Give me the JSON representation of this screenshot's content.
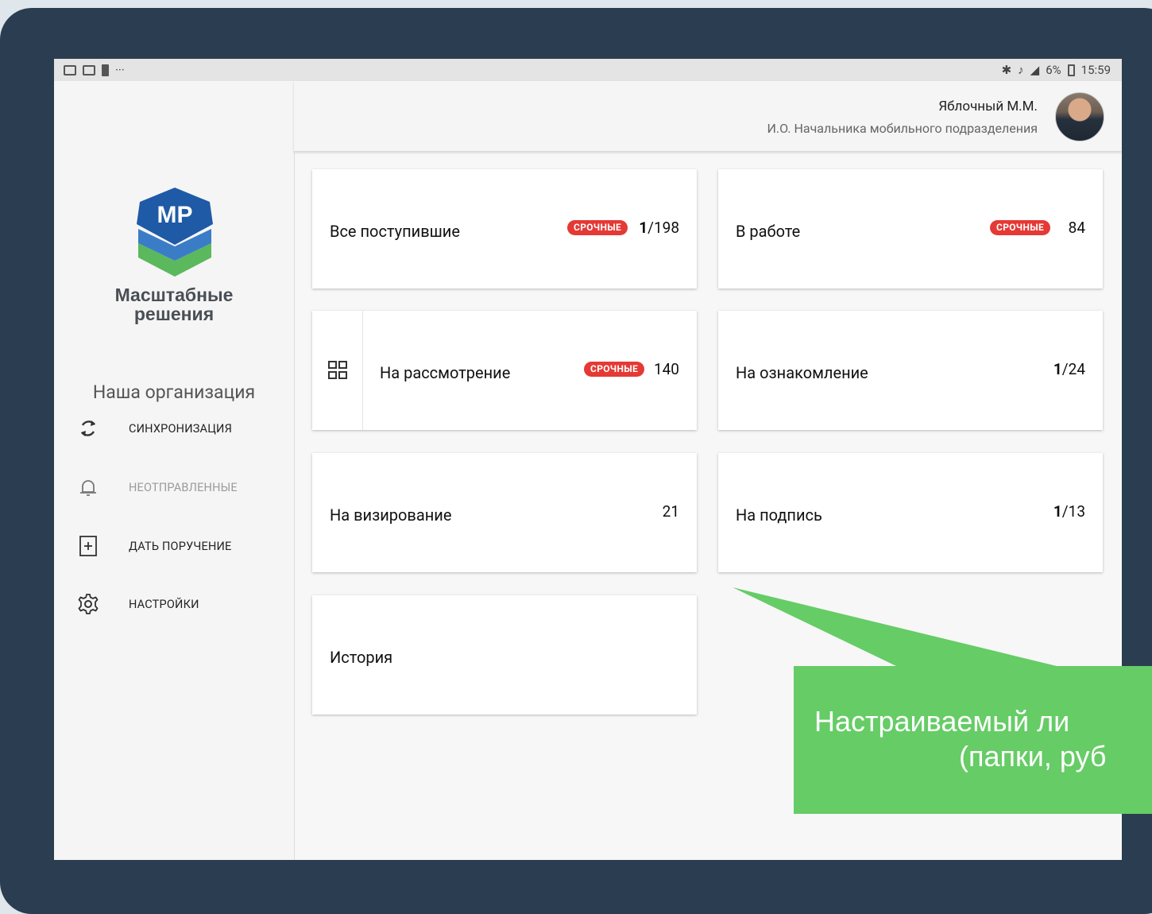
{
  "status_bar": {
    "left_dots": "···",
    "battery_percent": "6%",
    "time": "15:59"
  },
  "sidebar": {
    "logo_text": "MP",
    "brand_line1": "Масштабные",
    "brand_line2": "решения",
    "organization": "Наша организация",
    "items": [
      {
        "label": "СИНХРОНИЗАЦИЯ",
        "icon": "sync-icon",
        "enabled": true
      },
      {
        "label": "НЕОТПРАВЛЕННЫЕ",
        "icon": "bell-icon",
        "enabled": false
      },
      {
        "label": "ДАТЬ ПОРУЧЕНИЕ",
        "icon": "add-box-icon",
        "enabled": true
      },
      {
        "label": "НАСТРОЙКИ",
        "icon": "gear-icon",
        "enabled": true
      }
    ]
  },
  "header": {
    "user_name": "Яблочный М.М.",
    "user_role": "И.О. Начальника мобильного подразделения"
  },
  "cards": [
    {
      "title": "Все поступившие",
      "urgent": "СРОЧНЫЕ",
      "count_bold": "1",
      "count_rest": "/198"
    },
    {
      "title": "В работе",
      "urgent": "СРОЧНЫЕ",
      "count_bold": "",
      "count_rest": "84"
    },
    {
      "title": "На рассмотрение",
      "urgent": "СРОЧНЫЕ",
      "count_bold": "",
      "count_rest": "140"
    },
    {
      "title": "На ознакомление",
      "urgent": "",
      "count_bold": "1",
      "count_rest": "/24"
    },
    {
      "title": "На визирование",
      "urgent": "",
      "count_bold": "",
      "count_rest": "21"
    },
    {
      "title": "На подпись",
      "urgent": "",
      "count_bold": "1",
      "count_rest": "/13"
    },
    {
      "title": "История",
      "urgent": "",
      "count_bold": "",
      "count_rest": ""
    }
  ],
  "callout": {
    "line1": "Настраиваемый ли",
    "line2": "(папки, руб",
    "color": "#66cc66"
  },
  "colors": {
    "bezel": "#2b3d50",
    "urgent_badge": "#e53935",
    "logo_blue": "#1f5aa6",
    "logo_green": "#5cb85c"
  }
}
